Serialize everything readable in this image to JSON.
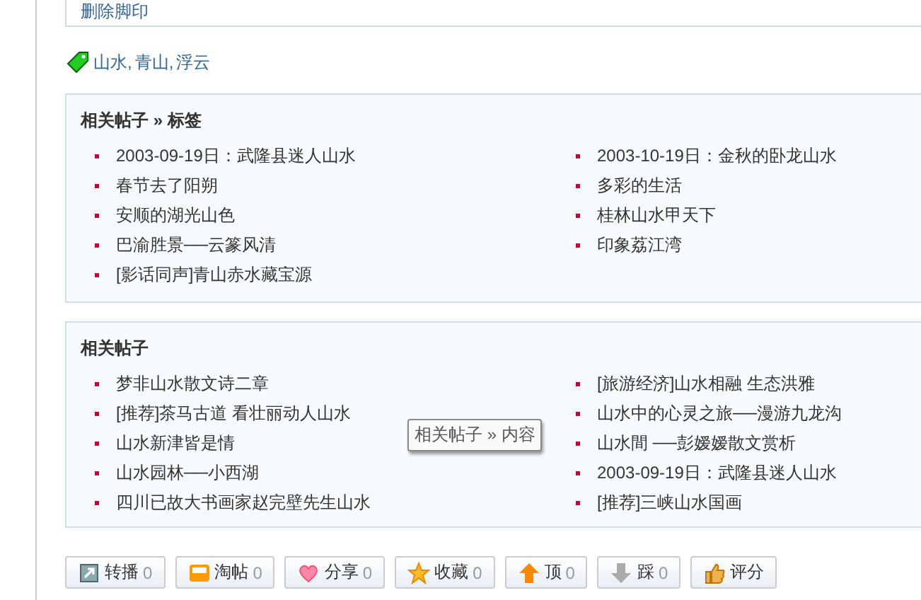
{
  "footprint_link": "删除脚印",
  "tags": [
    "山水",
    "青山",
    "浮云"
  ],
  "tag_separator": ",",
  "related_by_tag": {
    "title": "相关帖子 » 标签",
    "columns": [
      [
        "2003-09-19日：武隆县迷人山水",
        "春节去了阳朔",
        "安顺的湖光山色",
        "巴渝胜景──云篆风清",
        "[影话同声]青山赤水藏宝源"
      ],
      [
        "2003-10-19日：金秋的卧龙山水",
        "多彩的生活",
        "桂林山水甲天下",
        "印象荔江湾"
      ]
    ]
  },
  "related": {
    "title": "相关帖子",
    "columns": [
      [
        "梦非山水散文诗二章",
        "[推荐]茶马古道 看壮丽动人山水",
        "山水新津皆是情",
        "山水园林──小西湖",
        "四川已故大书画家赵完壁先生山水"
      ],
      [
        "[旅游经济]山水相融 生态洪雅",
        "山水中的心灵之旅──漫游九龙沟",
        "山水間 ──彭嫒嫒散文赏析",
        "2003-09-19日：武隆县迷人山水",
        "[推荐]三峡山水国画"
      ]
    ]
  },
  "tooltip": "相关帖子 » 内容",
  "actions": [
    {
      "kind": "repost",
      "label": "转播",
      "count": "0"
    },
    {
      "kind": "collect",
      "label": "淘帖",
      "count": "0"
    },
    {
      "kind": "share",
      "label": "分享",
      "count": "0"
    },
    {
      "kind": "favorite",
      "label": "收藏",
      "count": "0"
    },
    {
      "kind": "up",
      "label": "顶",
      "count": "0"
    },
    {
      "kind": "down",
      "label": "踩",
      "count": "0"
    },
    {
      "kind": "rate",
      "label": "评分"
    }
  ]
}
